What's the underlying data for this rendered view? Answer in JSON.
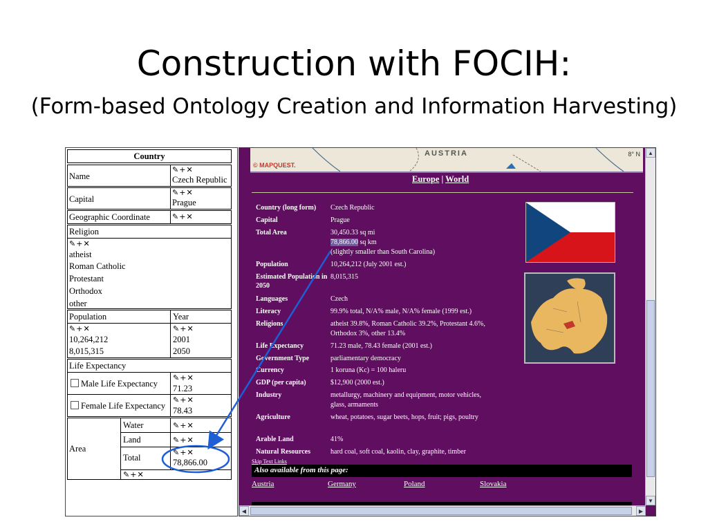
{
  "slide": {
    "title": "Construction with FOCIH:",
    "subtitle": "(Form-based Ontology Creation and Information Harvesting)"
  },
  "form": {
    "header": "Country",
    "tool_icons": {
      "edit": "✎",
      "add": "+",
      "remove": "✕"
    },
    "name": {
      "label": "Name",
      "value": "Czech Republic"
    },
    "capital": {
      "label": "Capital",
      "value": "Prague"
    },
    "geo": {
      "label": "Geographic Coordinate"
    },
    "religion": {
      "label": "Religion",
      "values": [
        "atheist",
        "Roman Catholic",
        "Protestant",
        "Orthodox",
        "other"
      ]
    },
    "population": {
      "label": "Population",
      "year_label": "Year",
      "values": [
        "10,264,212",
        "8,015,315"
      ],
      "years": [
        "2001",
        "2050"
      ]
    },
    "life": {
      "label": "Life Expectancy",
      "male_label": "Male Life Expectancy",
      "male_value": "71.23",
      "female_label": "Female Life Expectancy",
      "female_value": "78.43"
    },
    "area": {
      "label": "Area",
      "water_label": "Water",
      "land_label": "Land",
      "total_label": "Total",
      "total_value": "78,866.00"
    }
  },
  "browser": {
    "map": {
      "country": "AUSTRIA",
      "logo": "© MAPQUEST.",
      "coord": "8° N"
    },
    "links": {
      "europe": "Europe",
      "separator": "|",
      "world": "World"
    },
    "facts": [
      {
        "label": "Country (long form)",
        "value": "Czech Republic"
      },
      {
        "label": "Capital",
        "value": "Prague"
      },
      {
        "label": "Total Area",
        "value": "30,450.33 sq mi",
        "value2": "78,866.00",
        "value2_unit": " sq km",
        "value3": "(slightly smaller than South Carolina)"
      },
      {
        "label": "Population",
        "value": "10,264,212 (July 2001 est.)"
      },
      {
        "label": "Estimated Population in 2050",
        "value": "8,015,315"
      },
      {
        "label": "Languages",
        "value": "Czech"
      },
      {
        "label": "Literacy",
        "value": "99.9% total, N/A% male, N/A% female (1999 est.)"
      },
      {
        "label": "Religions",
        "value": "atheist 39.8%, Roman Catholic 39.2%, Protestant 4.6%, Orthodox 3%, other 13.4%"
      },
      {
        "label": "Life Expectancy",
        "value": "71.23 male, 78.43 female (2001 est.)"
      },
      {
        "label": "Government Type",
        "value": "parliamentary democracy"
      },
      {
        "label": "Currency",
        "value": "1 koruna (Kc) = 100 haleru"
      },
      {
        "label": "GDP (per capita)",
        "value": "$12,900 (2000 est.)"
      },
      {
        "label": "Industry",
        "value": "metallurgy, machinery and equipment, motor vehicles, glass, armaments"
      },
      {
        "label": "Agriculture",
        "value": "wheat, potatoes, sugar beets, hops, fruit; pigs, poultry"
      },
      {
        "label": "Arable Land",
        "value": "41%"
      },
      {
        "label": "Natural Resources",
        "value": "hard coal, soft coal, kaolin, clay, graphite, timber"
      }
    ],
    "skip_text": "Skip Text Links",
    "also_available": "Also available from this page:",
    "neighbors": [
      "Austria",
      "Germany",
      "Poland",
      "Slovakia"
    ],
    "colors": {
      "background": "#5f0e60",
      "flag_blue": "#11457e",
      "flag_red": "#d7141a",
      "annotation": "#1f5fd6"
    }
  }
}
